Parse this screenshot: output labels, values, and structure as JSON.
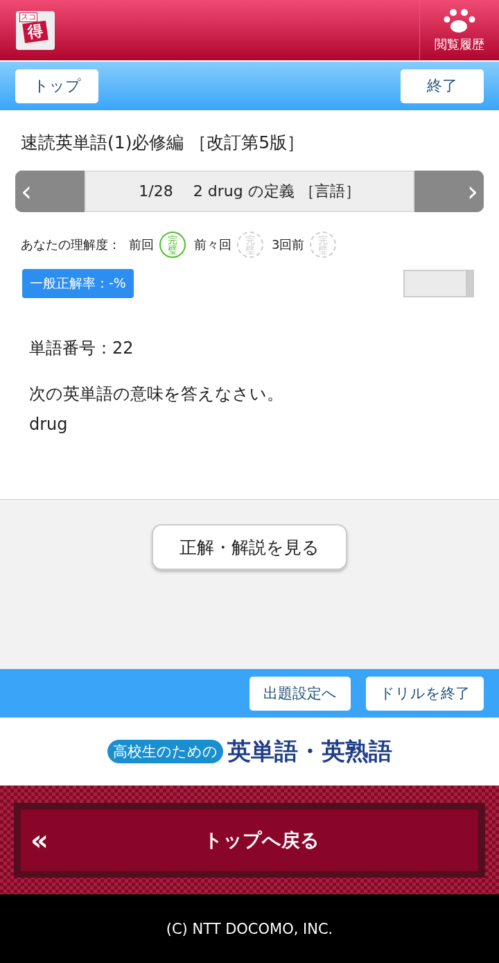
{
  "header": {
    "logo": {
      "small": "スコ",
      "main": "得"
    },
    "history_button": "閲覧履歴"
  },
  "top_bar": {
    "buttons": [
      "トップ",
      "終了"
    ]
  },
  "book_title": "速読英単語(1)必修編 ［改訂第5版］",
  "pager": {
    "prev": "‹",
    "label": "1/28　 2 drug の定義 ［言語］",
    "next": "›"
  },
  "understanding": {
    "label": "あなたの理解度：",
    "history": [
      {
        "label": "前回",
        "stamp": "完璧",
        "achieved": true
      },
      {
        "label": "前々回",
        "stamp": "完璧",
        "achieved": false
      },
      {
        "label": "3回前",
        "stamp": "完璧",
        "achieved": false
      }
    ]
  },
  "accuracy_badge": "一般正解率：-%",
  "toggle": {
    "on": false
  },
  "question": {
    "number": "単語番号：22",
    "prompt": "次の英単語の意味を答えなさい。",
    "word": "drug"
  },
  "answer_button": "正解・解説を見る",
  "bottom_bar": {
    "buttons": [
      "出題設定へ",
      "ドリルを終了"
    ]
  },
  "banner": {
    "tag": "高校生のための",
    "title": "英単語・英熟語"
  },
  "back_button": {
    "arrow": "«",
    "label": "トップへ戻る"
  },
  "footer": "(C) NTT DOCOMO, INC."
}
